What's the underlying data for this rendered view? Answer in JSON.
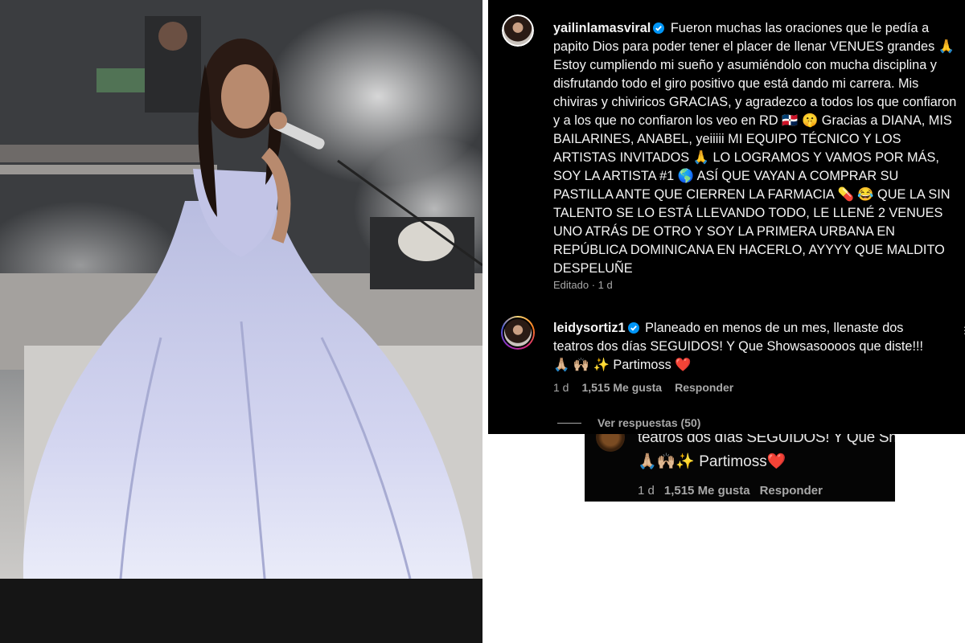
{
  "post": {
    "username": "yailinlamasviral",
    "caption": "Fueron muchas las oraciones que le pedía a papito Dios para poder tener el placer de llenar VENUES grandes 🙏 Estoy cumpliendo mi sueño y asumiéndolo con mucha disciplina y disfrutando todo el giro positivo que está dando mi carrera. Mis chiviras y chiviricos GRACIAS, y agradezco a todos los que confiaron y a los que no confiaron los veo en RD 🇩🇴 🤫 Gracias a DIANA, MIS BAILARINES, ANABEL, yeiiiii MI EQUIPO TÉCNICO Y LOS ARTISTAS INVITADOS 🙏 LO LOGRAMOS Y VAMOS POR MÁS, SOY LA ARTISTA #1 🌎 ASÍ QUE VAYAN A COMPRAR SU PASTILLA ANTE QUE CIERREN LA FARMACIA 💊 😂 QUE LA SIN TALENTO SE LO ESTÁ LLEVANDO TODO, LE LLENÉ 2 VENUES UNO ATRÁS DE OTRO Y SOY LA PRIMERA URBANA EN REPÚBLICA DOMINICANA EN HACERLO, AYYYY QUE MALDITO DESPELUÑE",
    "meta": "Editado · 1 d"
  },
  "comment": {
    "username": "leidysortiz1",
    "text": "Planeado en menos de un mes, llenaste dos teatros dos días SEGUIDOS! Y Que Showsasoooos que diste!!! 🙏🏼 🙌🏼 ✨ Partimoss ❤️",
    "time": "1 d",
    "likes": "1,515 Me gusta",
    "reply_label": "Responder",
    "view_replies": "Ver respuestas (50)"
  },
  "zoom": {
    "line1": "teatros dos días SEGUIDOS! Y Que Showsasoooos que diste!!!",
    "line2": "🙏🏼🙌🏼✨ Partimoss❤️",
    "time": "1 d",
    "likes": "1,515 Me gusta",
    "reply_label": "Responder"
  },
  "colors": {
    "panel_bg": "#000000",
    "text": "#f5f5f5",
    "muted": "#a8a8a8",
    "verified": "#0095f6",
    "dress": "#c9cbeb"
  }
}
